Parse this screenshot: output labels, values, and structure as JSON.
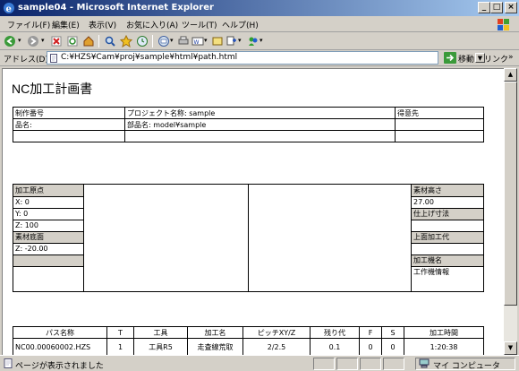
{
  "window": {
    "title": "sample04 - Microsoft Internet Explorer"
  },
  "menu": [
    "ファイル(F)",
    "編集(E)",
    "表示(V)",
    "お気に入り(A)",
    "ツール(T)",
    "ヘルプ(H)"
  ],
  "address": {
    "label": "アドレス(D)",
    "url": "C:¥HZS¥Cam¥proj¥sample¥html¥path.html",
    "go_label": "移動",
    "links_label": "リンク"
  },
  "page": {
    "title": "NC加工計画書",
    "header_table": {
      "row1": [
        "制作番号",
        "プロジェクト名称: sample",
        "得意先"
      ],
      "row2": [
        "品名:",
        "部品名: model¥sample",
        ""
      ]
    },
    "origin": {
      "label": "加工原点",
      "x": "X: 0",
      "y": "Y: 0",
      "z": "Z: 100",
      "bottom_label": "素材底面",
      "bottom_z": "Z: -20.00"
    },
    "right_info": {
      "stock_height_label": "素材高さ",
      "stock_height_value": "27.00",
      "finish_label": "仕上げ寸法",
      "top_face_label": "上面加工代",
      "machine_label": "加工機名",
      "machine_info_label": "工作機情報"
    },
    "path_table": {
      "headers": [
        "パス名称",
        "T",
        "工具",
        "加工名",
        "ピッチXY/Z",
        "残り代",
        "F",
        "S",
        "加工時間"
      ],
      "rows": [
        [
          "NC00.00060002.HZS",
          "1",
          "工具R5",
          "走査線荒取",
          "2/2.5",
          "0.1",
          "0",
          "0",
          "1:20:38"
        ]
      ]
    }
  },
  "status": {
    "text": "ページが表示されました",
    "zone": "マイ コンピュータ"
  }
}
